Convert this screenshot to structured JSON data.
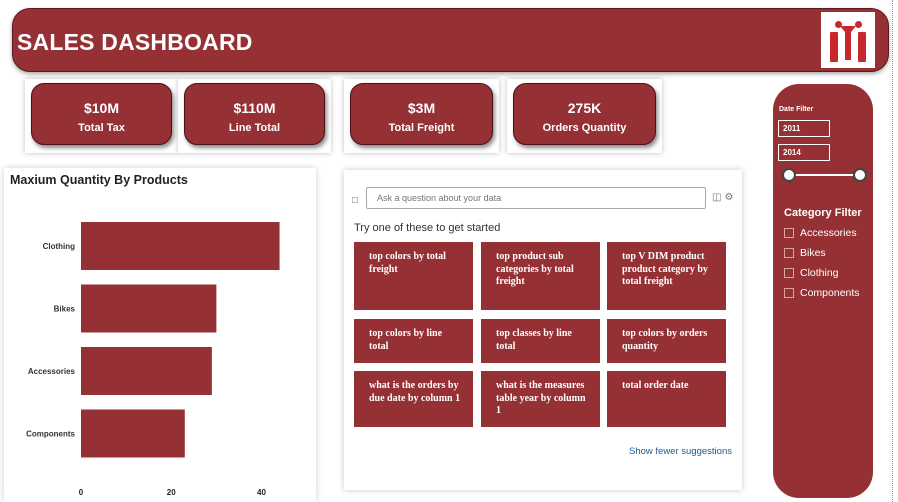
{
  "header": {
    "title": "SALES DASHBOARD",
    "logo_icon": "iti-logo"
  },
  "kpis": [
    {
      "value": "$10M",
      "label": "Total Tax"
    },
    {
      "value": "$110M",
      "label": "Line Total"
    },
    {
      "value": "$3M",
      "label": "Total Freight"
    },
    {
      "value": "275K",
      "label": "Orders Quantity"
    }
  ],
  "chart_data": {
    "type": "bar",
    "orientation": "horizontal",
    "title": "Maxium Quantity By Products",
    "categories": [
      "Clothing",
      "Bikes",
      "Accessories",
      "Components"
    ],
    "values": [
      44,
      30,
      29,
      23
    ],
    "x_ticks": [
      "0",
      "20",
      "40"
    ],
    "xlim": [
      0,
      50
    ],
    "bar_color": "#953035"
  },
  "qa": {
    "placeholder": "Ask a question about your data",
    "hint": "Try one of these to get started",
    "suggestions": [
      "top colors by total freight",
      "top product sub categories by total freight",
      "top V DIM product product category by total freight",
      "top colors by line total",
      "top classes by line total",
      "top colors by orders quantity",
      "what is the orders by due date by column 1",
      "what is the measures table year by column 1",
      "total order date"
    ],
    "show_fewer": "Show fewer suggestions"
  },
  "filters": {
    "date_label": "Date Filter",
    "date_start": "2011",
    "date_end": "2014",
    "category_label": "Category Filter",
    "categories": [
      "Accessories",
      "Bikes",
      "Clothing",
      "Components"
    ]
  },
  "colors": {
    "brand": "#953035",
    "white": "#ffffff"
  }
}
